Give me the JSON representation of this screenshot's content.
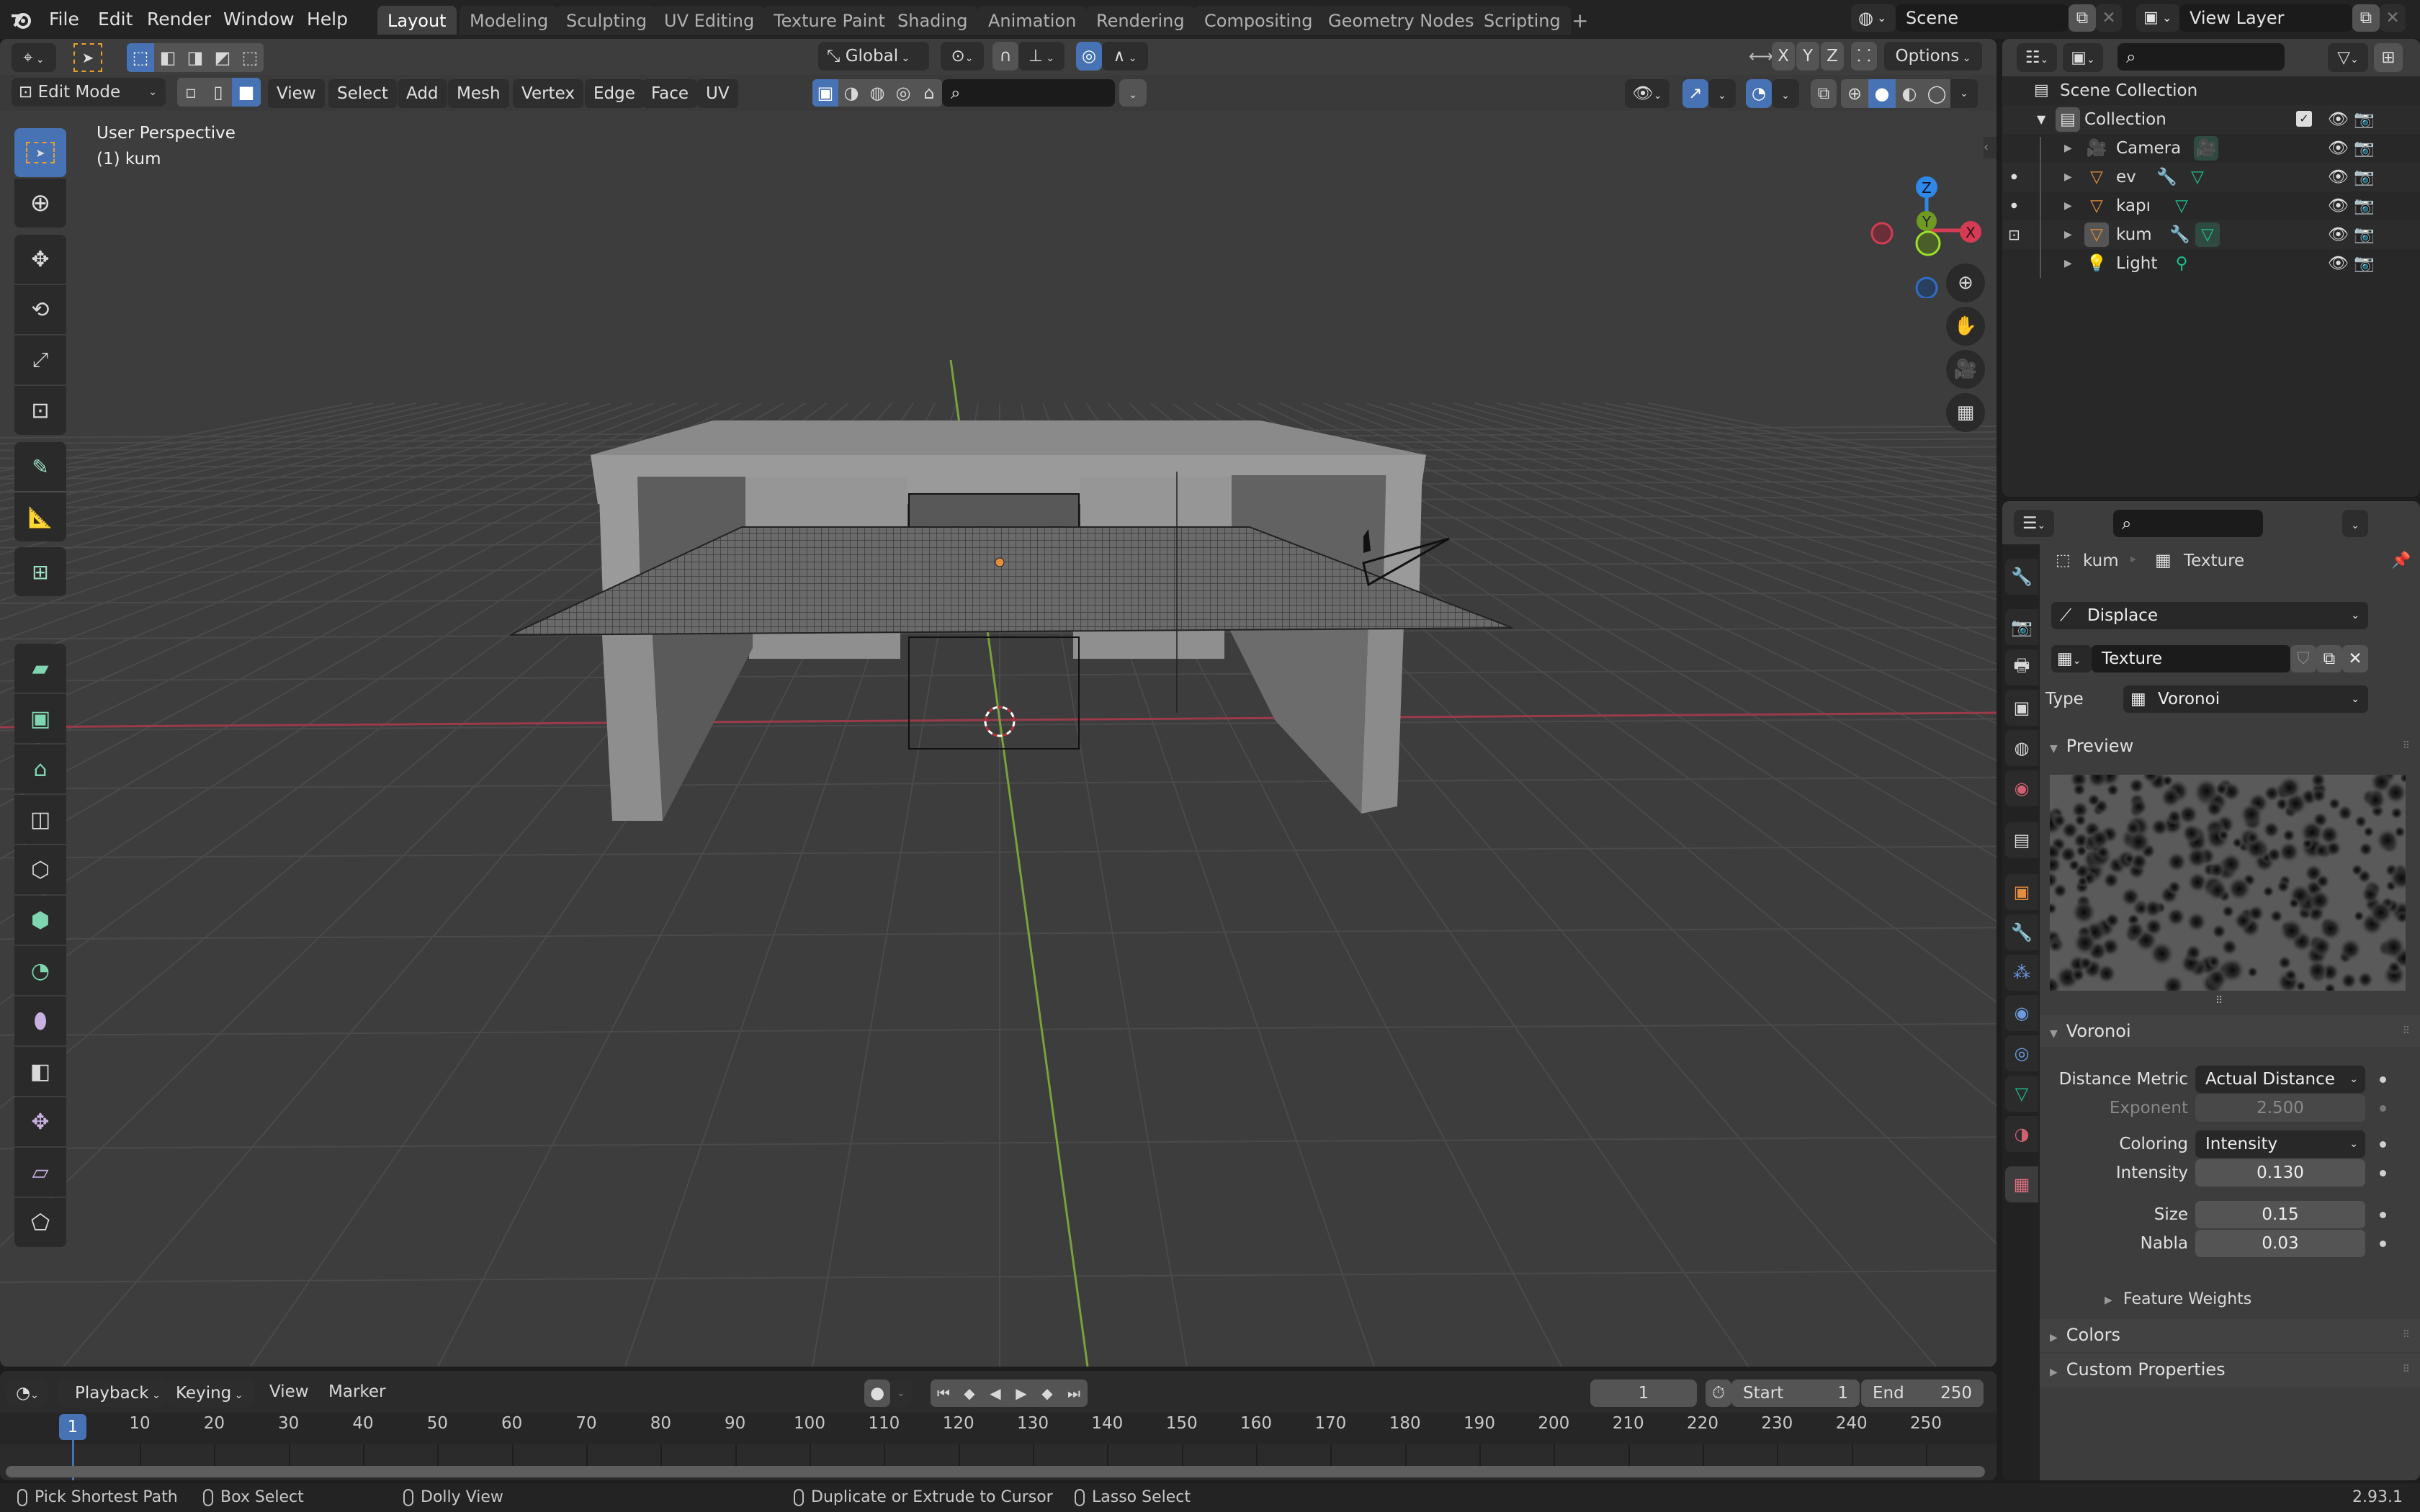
{
  "app": {
    "version": "2.93.1"
  },
  "menubar": {
    "items": [
      "File",
      "Edit",
      "Render",
      "Window",
      "Help"
    ],
    "workspaces": [
      "Layout",
      "Modeling",
      "Sculpting",
      "UV Editing",
      "Texture Paint",
      "Shading",
      "Animation",
      "Rendering",
      "Compositing",
      "Geometry Nodes",
      "Scripting"
    ],
    "active_workspace": "Layout",
    "scene_name": "Scene",
    "view_layer_name": "View Layer"
  },
  "viewport": {
    "mode": "Edit Mode",
    "menus": [
      "View",
      "Select",
      "Add",
      "Mesh",
      "Vertex",
      "Edge",
      "Face",
      "UV"
    ],
    "orientation": "Global",
    "options_label": "Options",
    "axis_buttons": [
      "X",
      "Y",
      "Z"
    ],
    "overlay_title": "User Perspective",
    "overlay_object": "(1) kum",
    "gizmo_axes": {
      "z": "Z",
      "y": "Y",
      "x": "X"
    }
  },
  "tools": [
    "select-box",
    "cursor",
    "move",
    "rotate",
    "scale",
    "transform",
    "annotate",
    "measure",
    "add-cube",
    "extrude-region",
    "inset-faces",
    "bevel",
    "loop-cut",
    "knife",
    "poly-build",
    "spin",
    "smooth",
    "edge-slide",
    "shrink-fatten",
    "shear",
    "rip-region"
  ],
  "outliner": {
    "root": "Scene Collection",
    "collection": "Collection",
    "objects": [
      {
        "name": "Camera",
        "type": "camera",
        "modifiers": false,
        "data": "camera-data"
      },
      {
        "name": "ev",
        "type": "mesh",
        "modifiers": true,
        "data": "mesh-data"
      },
      {
        "name": "kapı",
        "type": "mesh",
        "modifiers": false,
        "data": "mesh-data"
      },
      {
        "name": "kum",
        "type": "mesh",
        "modifiers": true,
        "data": "mesh-data",
        "active": true
      },
      {
        "name": "Light",
        "type": "light",
        "modifiers": false,
        "data": "light-data"
      }
    ]
  },
  "properties": {
    "breadcrumb": {
      "object": "kum",
      "texture": "Texture"
    },
    "modifier_selector": "Displace",
    "texture_name": "Texture",
    "type_label": "Type",
    "type_value": "Voronoi",
    "preview_label": "Preview",
    "voronoi_label": "Voronoi",
    "fields": [
      {
        "label": "Distance Metric",
        "value": "Actual Distance",
        "kind": "dropdown"
      },
      {
        "label": "Exponent",
        "value": "2.500",
        "kind": "disabled"
      },
      {
        "label": "Coloring",
        "value": "Intensity",
        "kind": "dropdown"
      },
      {
        "label": "Intensity",
        "value": "0.130",
        "kind": "number"
      },
      {
        "label": "Size",
        "value": "0.15",
        "kind": "number"
      },
      {
        "label": "Nabla",
        "value": "0.03",
        "kind": "number"
      }
    ],
    "subpanels": [
      "Feature Weights"
    ],
    "collapsed_panels": [
      "Colors",
      "Custom Properties"
    ]
  },
  "timeline": {
    "menus": [
      "Playback",
      "Keying",
      "View",
      "Marker"
    ],
    "current_frame": "1",
    "start_label": "Start",
    "start": "1",
    "end_label": "End",
    "end": "250",
    "ticks": [
      "10",
      "20",
      "30",
      "40",
      "50",
      "60",
      "70",
      "80",
      "90",
      "100",
      "110",
      "120",
      "130",
      "140",
      "150",
      "160",
      "170",
      "180",
      "190",
      "200",
      "210",
      "220",
      "230",
      "240",
      "250"
    ],
    "playhead": "1"
  },
  "statusbar": {
    "hints": [
      "Pick Shortest Path",
      "Box Select",
      "Dolly View",
      "Duplicate or Extrude to Cursor",
      "Lasso Select"
    ]
  },
  "colors": {
    "accent": "#4772b3",
    "x_axis": "#d43b54",
    "y_axis": "#6f9a21",
    "z_axis": "#2d88e8",
    "object_orange": "#e48d3c",
    "data_green": "#1fbf8f"
  }
}
